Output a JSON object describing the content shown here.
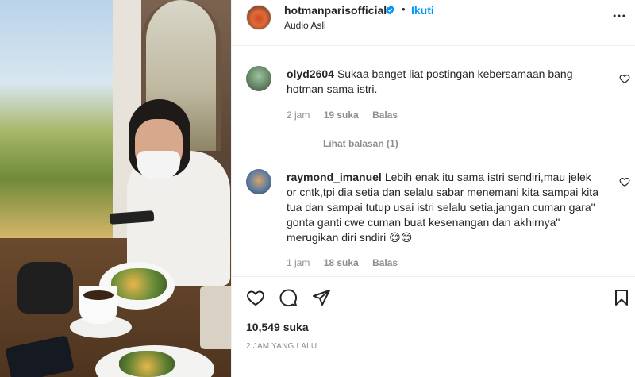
{
  "post": {
    "username": "hotmanparisofficial",
    "follow_label": "Ikuti",
    "separator": "•",
    "audio": "Audio Asli",
    "likes": "10,549 suka",
    "time_ago": "2 JAM YANG LALU"
  },
  "comments": [
    {
      "username": "olyd2604",
      "text": "Sukaa banget liat postingan kebersamaan bang hotman sama istri.",
      "time": "2 jam",
      "likes": "19 suka",
      "reply_label": "Balas"
    },
    {
      "username": "raymond_imanuel",
      "text": "Lebih enak itu sama istri sendiri,mau jelek or cntk,tpi dia setia dan selalu sabar menemani kita sampai kita tua dan sampai tutup usai istri selalu setia,jangan cuman gara\" gonta ganti cwe cuman buat kesenangan dan akhirnya\" merugikan diri sndiri 😊😊",
      "time": "1 jam",
      "likes": "18 suka",
      "reply_label": "Balas"
    }
  ],
  "view_replies": "Lihat balasan (1)",
  "colors": {
    "accent": "#0095f6",
    "text": "#262626",
    "muted": "#8e8e8e"
  },
  "icons": {
    "verified": "verified-badge-icon",
    "more": "more-options-icon",
    "heart": "heart-icon",
    "like": "like-icon",
    "comment": "comment-icon",
    "share": "share-icon",
    "save": "bookmark-icon"
  }
}
